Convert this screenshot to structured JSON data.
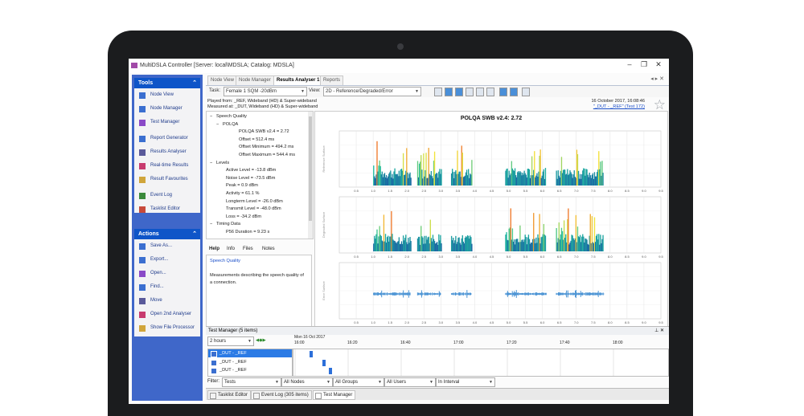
{
  "window": {
    "title": "MultiDSLA Controller [Server: local\\MDSLA; Catalog: MDSLA]"
  },
  "sidebar": {
    "tools_header": "Tools",
    "tools": [
      {
        "label": "Node View",
        "icon": "node-view-icon"
      },
      {
        "label": "Node Manager",
        "icon": "node-manager-icon"
      },
      {
        "label": "Test Manager",
        "icon": "test-manager-icon"
      },
      {
        "label": "Report Generator",
        "icon": "report-generator-icon"
      },
      {
        "label": "Results Analyser",
        "icon": "results-analyser-icon"
      },
      {
        "label": "Real-time Results",
        "icon": "realtime-results-icon"
      },
      {
        "label": "Result Favourites",
        "icon": "result-favourites-icon"
      },
      {
        "label": "Event Log",
        "icon": "event-log-icon"
      },
      {
        "label": "Tasklist Editor",
        "icon": "tasklist-editor-icon"
      }
    ],
    "actions_header": "Actions",
    "actions": [
      {
        "label": "Save As...",
        "icon": "save-as-icon"
      },
      {
        "label": "Export...",
        "icon": "export-icon"
      },
      {
        "label": "Open...",
        "icon": "open-icon"
      },
      {
        "label": "Find...",
        "icon": "find-icon"
      },
      {
        "label": "Move",
        "icon": "move-icon"
      },
      {
        "label": "Open 2nd Analyser",
        "icon": "open-analyser-icon"
      },
      {
        "label": "Show File Processor",
        "icon": "file-processor-icon"
      }
    ]
  },
  "tabs": [
    "Node View",
    "Node Manager",
    "Results Analyser 1",
    "Reports"
  ],
  "toolbar": {
    "task_label": "Task:",
    "task_value": "Female 1 SQM -20dBm",
    "view_label": "View:",
    "view_value": "2D - Reference/Degraded/Error"
  },
  "info": {
    "played_from": "Played from: _REF, Wideband (HD) & Super-wideband",
    "measured_at": "Measured at: _DUT, Wideband (HD) & Super-wideband",
    "date": "16 October 2017, 16:08:46",
    "link": "\"_DUT - _REF\" (Test 172)"
  },
  "tree": [
    {
      "text": "Speech Quality",
      "level": 0,
      "toggle": "−"
    },
    {
      "text": "POLQA",
      "level": 1,
      "toggle": "−"
    },
    {
      "text": "POLQA SWB v2.4 = 2.72",
      "level": 2
    },
    {
      "text": "Offset = 512.4 ms",
      "level": 2
    },
    {
      "text": "Offset Minimum = 494.2 ms",
      "level": 2
    },
    {
      "text": "Offset Maximum = 544.4 ms",
      "level": 2
    },
    {
      "text": "Levels",
      "level": 0,
      "toggle": "−"
    },
    {
      "text": "Active Level = -13.8 dBm",
      "level": 1
    },
    {
      "text": "Noise Level = -73.5 dBm",
      "level": 1
    },
    {
      "text": "Peak = 0.9 dBm",
      "level": 1
    },
    {
      "text": "Activity = 61.1 %",
      "level": 1
    },
    {
      "text": "Longterm Level = -26.0 dBm",
      "level": 1
    },
    {
      "text": "Transmit Level = -48.0 dBm",
      "level": 1
    },
    {
      "text": "Loss = -34.2 dBm",
      "level": 1
    },
    {
      "text": "Timing Data",
      "level": 0,
      "toggle": "−"
    },
    {
      "text": "P56 Duration = 9.23 s",
      "level": 1
    }
  ],
  "info_tabs": [
    "Help",
    "Info",
    "Files",
    "Notes"
  ],
  "help": {
    "title": "Speech Quality",
    "body": "Measurements describing the speech quality of a connection."
  },
  "chart_data": {
    "type": "spectrogram",
    "title": "POLQA SWB v2.4: 2.72",
    "panels": [
      "Reference Surface",
      "Degraded Surface",
      "Error Surface"
    ],
    "x_ticks": [
      0.5,
      1.0,
      1.5,
      2.0,
      2.5,
      3.0,
      3.5,
      4.0,
      4.5,
      5.0,
      5.5,
      6.0,
      6.5,
      7.0,
      7.5,
      8.0,
      8.5,
      9.0,
      9.5
    ],
    "xlim": [
      0.0,
      9.5
    ],
    "bursts": [
      {
        "start": 1.0,
        "end": 2.1
      },
      {
        "start": 2.3,
        "end": 3.0
      },
      {
        "start": 3.3,
        "end": 3.9
      },
      {
        "start": 4.9,
        "end": 6.1
      },
      {
        "start": 6.4,
        "end": 7.8
      }
    ],
    "colors": {
      "low": "#1b2fa6",
      "mid": "#1fbfa0",
      "high": "#f3e43b",
      "peak": "#f07a2d",
      "error": "#4a93d4"
    }
  },
  "test_manager": {
    "header": "Test Manager (5 items)",
    "range_value": "2 hours",
    "date_label": "Mon 16 Oct 2017",
    "time_labels": [
      "16:00",
      "16:20",
      "16:40",
      "17:00",
      "17:20",
      "17:40",
      "18:00"
    ],
    "rows": [
      "_DUT - _REF",
      "_DUT - _REF",
      "_DUT - _REF"
    ]
  },
  "filter": {
    "label": "Filter:",
    "tests": "Tests",
    "nodes": "All Nodes",
    "groups": "All Groups",
    "users": "All Users",
    "interval": "In Interval"
  },
  "bottom_tabs": [
    "Tasklist Editor",
    "Event Log (305 items)",
    "Test Manager"
  ]
}
